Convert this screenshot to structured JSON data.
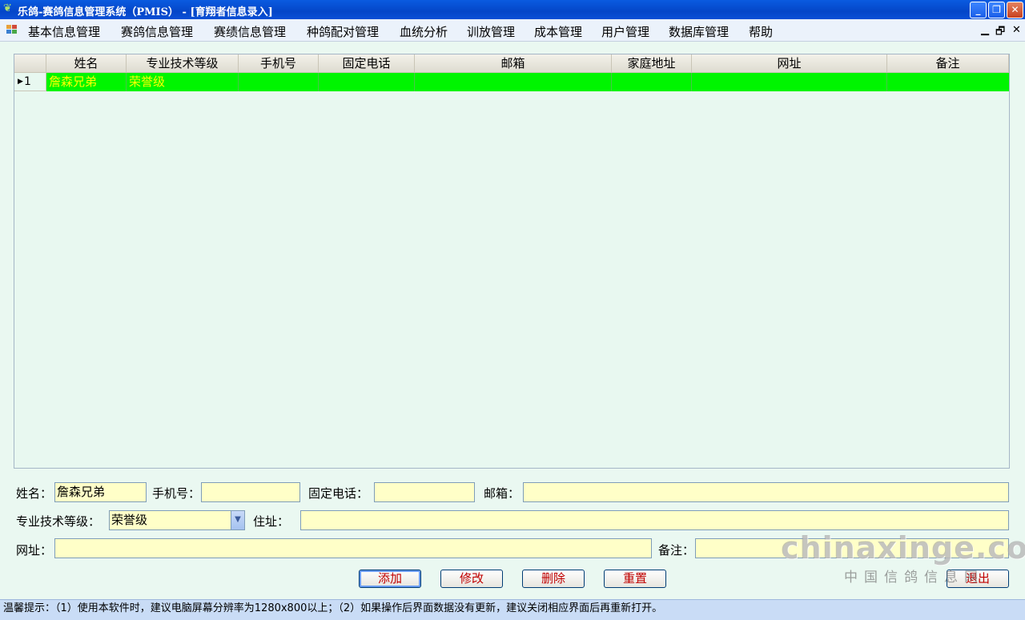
{
  "window": {
    "title": "乐鸽-赛鸽信息管理系统（PMIS） - [育翔者信息录入]",
    "buttons": {
      "minimize": "_",
      "restore": "❐",
      "close": "✕"
    }
  },
  "menu": {
    "items": [
      "基本信息管理",
      "赛鸽信息管理",
      "赛绩信息管理",
      "种鸽配对管理",
      "血统分析",
      "训放管理",
      "成本管理",
      "用户管理",
      "数据库管理",
      "帮助"
    ],
    "mdi_controls": {
      "minimize": "▁",
      "restore": "🗗",
      "close": "✕"
    }
  },
  "grid": {
    "columns": [
      "姓名",
      "专业技术等级",
      "手机号",
      "固定电话",
      "邮箱",
      "家庭地址",
      "网址",
      "备注"
    ],
    "rows": [
      {
        "index": "1",
        "cells": [
          "詹森兄弟",
          "荣誉级",
          "",
          "",
          "",
          "",
          "",
          ""
        ]
      }
    ],
    "selected_row_color": "#00f500",
    "selected_text_color": "#ffff00"
  },
  "form": {
    "name_label": "姓名：",
    "name_value": "詹森兄弟",
    "mobile_label": "手机号：",
    "mobile_value": "",
    "phone_label": "固定电话：",
    "phone_value": "",
    "email_label": "邮箱：",
    "email_value": "",
    "grade_label": "专业技术等级：",
    "grade_value": "荣誉级",
    "address_label": "住址：",
    "address_value": "",
    "website_label": "网址：",
    "website_value": "",
    "note_label": "备注：",
    "note_value": ""
  },
  "actions": {
    "add": "添加",
    "edit": "修改",
    "delete": "删除",
    "reset": "重置",
    "exit": "退出"
  },
  "watermark": {
    "main": "chinaxinge.com",
    "sub": "中国信鸽信息网"
  },
  "status": {
    "text": "温馨提示：（1）使用本软件时，建议电脑屏幕分辨率为1280x800以上；（2）如果操作后界面数据没有更新，建议关闭相应界面后再重新打开。"
  },
  "icons": {
    "app": "pigeon-icon",
    "menu": "mdi-window-icon",
    "row_indicator": "row-pointer-icon",
    "dropdown": "chevron-down-icon"
  }
}
